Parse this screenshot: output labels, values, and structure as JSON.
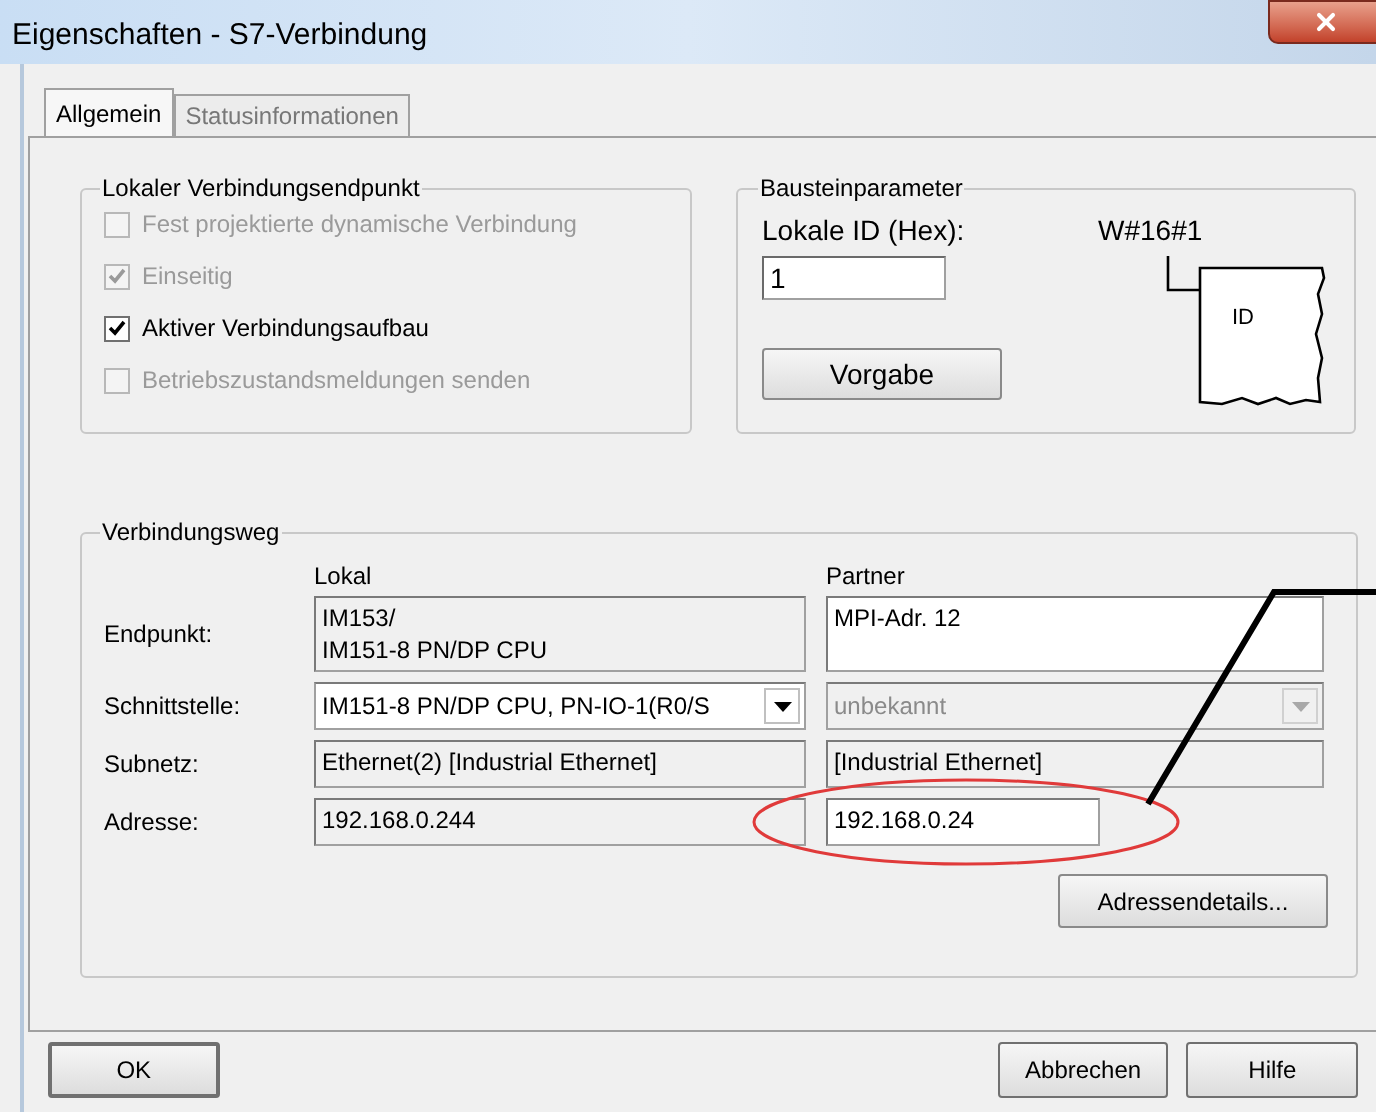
{
  "window": {
    "title": "Eigenschaften - S7-Verbindung"
  },
  "tabs": [
    {
      "label": "Allgemein",
      "selected": true
    },
    {
      "label": "Statusinformationen",
      "selected": false
    }
  ],
  "local_endpoint": {
    "title": "Lokaler Verbindungsendpunkt",
    "checkboxes": [
      {
        "label": "Fest projektierte dynamische Verbindung",
        "checked": false,
        "disabled": true
      },
      {
        "label": "Einseitig",
        "checked": true,
        "disabled": true
      },
      {
        "label": "Aktiver Verbindungsaufbau",
        "checked": true,
        "disabled": false
      },
      {
        "label": "Betriebszustandsmeldungen senden",
        "checked": false,
        "disabled": true
      }
    ]
  },
  "block_parameters": {
    "title": "Bausteinparameter",
    "local_id_label": "Lokale ID (Hex):",
    "local_id_value": "1",
    "id_value": "W#16#1",
    "pin_label": "ID",
    "default_button": "Vorgabe"
  },
  "connection_path": {
    "title": "Verbindungsweg",
    "columns": [
      "Lokal",
      "Partner"
    ],
    "rows": [
      {
        "label": "Endpunkt:",
        "local": {
          "kind": "text",
          "lines": [
            "IM153/",
            "IM151-8 PN/DP CPU"
          ],
          "editable": false
        },
        "partner": {
          "kind": "text",
          "lines": [
            "MPI-Adr. 12"
          ],
          "editable": true
        }
      },
      {
        "label": "Schnittstelle:",
        "local": {
          "kind": "dropdown",
          "lines": [
            "IM151-8 PN/DP CPU, PN-IO-1(R0/S"
          ],
          "editable": true
        },
        "partner": {
          "kind": "dropdown",
          "lines": [
            "unbekannt"
          ],
          "editable": false
        }
      },
      {
        "label": "Subnetz:",
        "local": {
          "kind": "text",
          "lines": [
            "Ethernet(2) [Industrial Ethernet]"
          ],
          "editable": false
        },
        "partner": {
          "kind": "text",
          "lines": [
            "[Industrial Ethernet]"
          ],
          "editable": false
        }
      },
      {
        "label": "Adresse:",
        "local": {
          "kind": "text",
          "lines": [
            "192.168.0.244"
          ],
          "editable": false
        },
        "partner": {
          "kind": "short",
          "lines": [
            "192.168.0.24"
          ],
          "editable": true
        }
      }
    ],
    "details_button": "Adressendetails..."
  },
  "buttons": [
    "OK",
    "Abbrechen",
    "Hilfe"
  ]
}
